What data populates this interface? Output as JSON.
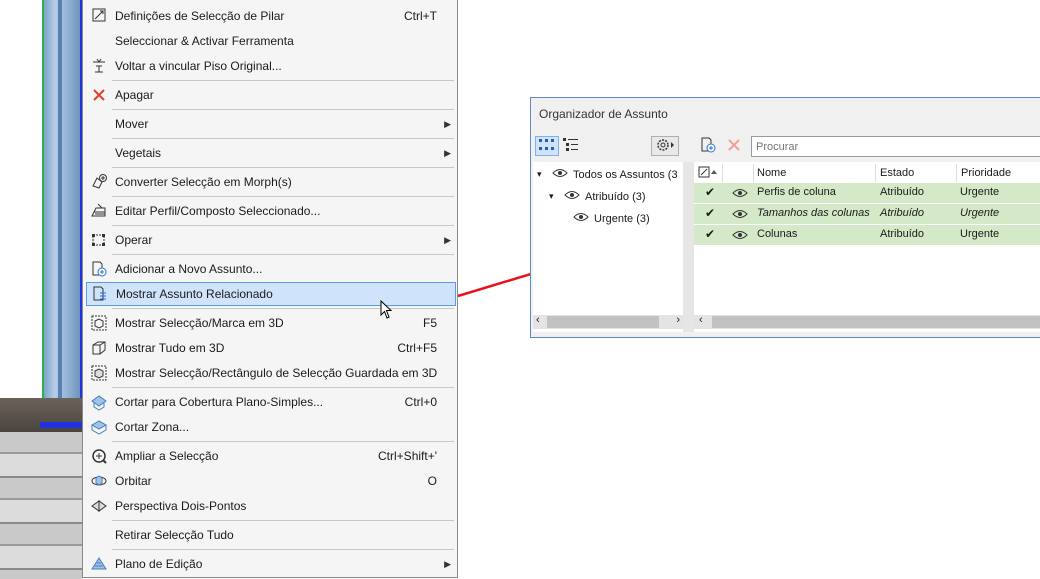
{
  "menu": {
    "items": [
      {
        "label": "Definições de Selecção de Pilar",
        "shortcut": "Ctrl+T"
      },
      {
        "label": "Seleccionar & Activar Ferramenta",
        "shortcut": ""
      },
      {
        "label": "Voltar a vincular Piso Original...",
        "shortcut": ""
      },
      {
        "label": "Apagar",
        "shortcut": ""
      },
      {
        "label": "Mover",
        "shortcut": ""
      },
      {
        "label": "Vegetais",
        "shortcut": ""
      },
      {
        "label": "Converter Selecção em Morph(s)",
        "shortcut": ""
      },
      {
        "label": "Editar Perfil/Composto Seleccionado...",
        "shortcut": ""
      },
      {
        "label": "Operar",
        "shortcut": ""
      },
      {
        "label": "Adicionar a Novo Assunto...",
        "shortcut": ""
      },
      {
        "label": "Mostrar Assunto Relacionado",
        "shortcut": ""
      },
      {
        "label": "Mostrar Selecção/Marca em 3D",
        "shortcut": "F5"
      },
      {
        "label": "Mostrar Tudo em 3D",
        "shortcut": "Ctrl+F5"
      },
      {
        "label": "Mostrar Selecção/Rectângulo de Selecção Guardada em 3D",
        "shortcut": ""
      },
      {
        "label": "Cortar para Cobertura Plano-Simples...",
        "shortcut": "Ctrl+0"
      },
      {
        "label": "Cortar Zona...",
        "shortcut": ""
      },
      {
        "label": "Ampliar a Selecção",
        "shortcut": "Ctrl+Shift+'"
      },
      {
        "label": "Orbitar",
        "shortcut": "O"
      },
      {
        "label": "Perspectiva Dois-Pontos",
        "shortcut": ""
      },
      {
        "label": "Retirar Selecção Tudo",
        "shortcut": ""
      },
      {
        "label": "Plano de Edição",
        "shortcut": ""
      }
    ]
  },
  "organizer": {
    "title": "Organizador de Assunto",
    "search_placeholder": "Procurar",
    "tree": [
      {
        "label": "Todos os Assuntos (3"
      },
      {
        "label": "Atribuído (3)"
      },
      {
        "label": "Urgente (3)"
      }
    ],
    "columns": {
      "name": "Nome",
      "status": "Estado",
      "priority": "Prioridade"
    },
    "rows": [
      {
        "name": "Perfis de coluna",
        "status": "Atribuído",
        "priority": "Urgente"
      },
      {
        "name": "Tamanhos das colunas",
        "status": "Atribuído",
        "priority": "Urgente"
      },
      {
        "name": "Colunas",
        "status": "Atribuído",
        "priority": "Urgente"
      }
    ]
  },
  "colors": {
    "highlight": "#cfe4fb",
    "row_green": "#d4e9c7",
    "arrow": "#e8141c",
    "delete_icon": "#e04030"
  }
}
